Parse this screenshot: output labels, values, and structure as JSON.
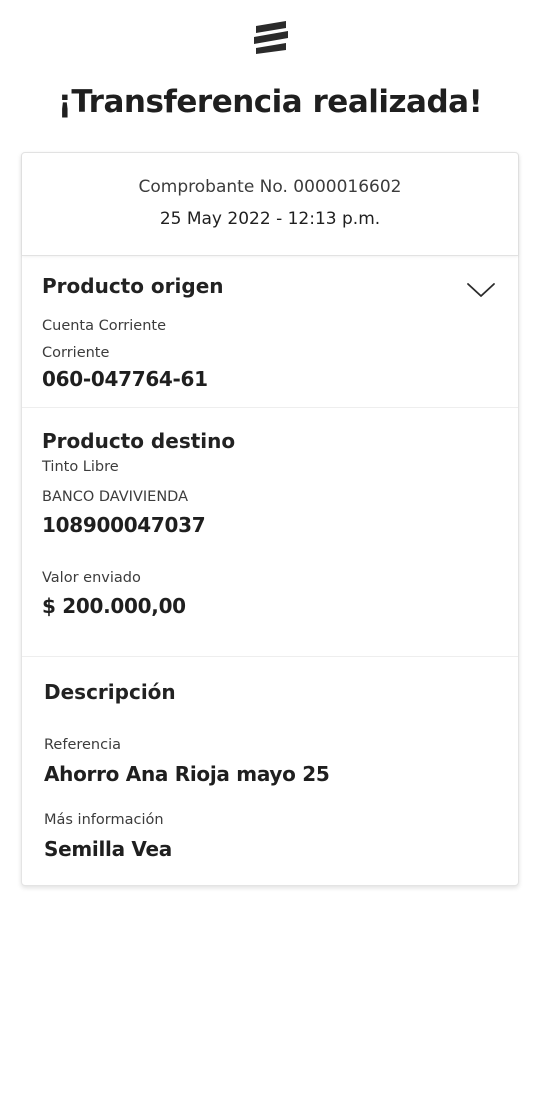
{
  "header": {
    "title": "¡Transferencia realizada!"
  },
  "receipt": {
    "number": "Comprobante No. 0000016602",
    "datetime": "25 May 2022 - 12:13 p.m."
  },
  "origin": {
    "title": "Producto origen",
    "account_type": "Cuenta Corriente",
    "account_subtype": "Corriente",
    "account_number": "060-047764-61",
    "expand_icon": "chevron-down-icon"
  },
  "destination": {
    "title": "Producto destino",
    "account_name": "Tinto Libre",
    "bank": "BANCO DAVIVIENDA",
    "account_number": "108900047037",
    "amount_label": "Valor enviado",
    "amount": "$ 200.000,00"
  },
  "description": {
    "title": "Descripción",
    "reference_label": "Referencia",
    "reference_value": "Ahorro Ana Rioja mayo 25",
    "more_info_label": "Más información",
    "more_info_value": "Semilla Vea"
  },
  "colors": {
    "text": "#1f1f1f",
    "muted": "#3c3c3c",
    "border": "#e4e4e4",
    "logo": "#2b2b2b"
  }
}
